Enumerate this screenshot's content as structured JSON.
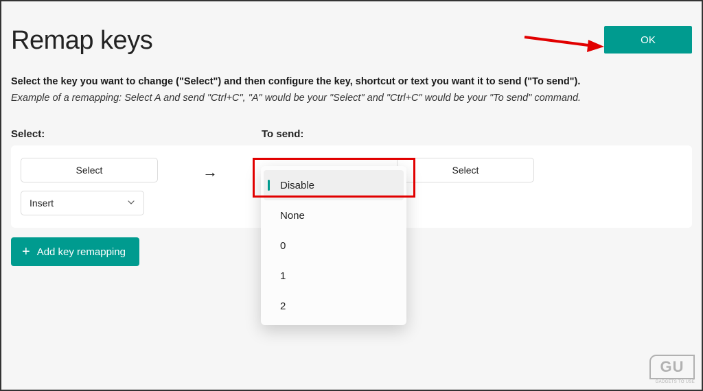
{
  "header": {
    "title": "Remap keys",
    "ok_label": "OK"
  },
  "instruction": "Select the key you want to change (\"Select\") and then configure the key, shortcut or text you want it to send (\"To send\").",
  "example": "Example of a remapping: Select A and send \"Ctrl+C\", \"A\" would be your \"Select\" and \"Ctrl+C\" would be your \"To send\" command.",
  "columns": {
    "select_label": "Select:",
    "tosend_label": "To send:"
  },
  "mapping": {
    "left_select_button": "Select",
    "left_dropdown_value": "Insert",
    "arrow": "→",
    "right_select_button": "Select"
  },
  "dropdown_options": [
    "Disable",
    "None",
    "0",
    "1",
    "2"
  ],
  "dropdown_selected_index": 0,
  "add_button_label": "Add key remapping",
  "watermark": {
    "logo": "GU",
    "text": "GADGETS TO USE"
  },
  "colors": {
    "accent": "#009b8f",
    "highlight_red": "#e10000"
  }
}
